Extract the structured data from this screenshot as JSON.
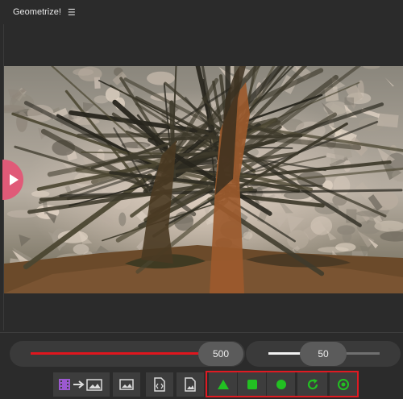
{
  "app": {
    "title": "Geometrize!",
    "menu_icon": "hamburger-menu-icon"
  },
  "canvas": {
    "description_icon": "geometrized-tree-image",
    "side_tab_icon": "play-icon"
  },
  "sliders": {
    "shape_count": {
      "value": "500",
      "fill_fraction": 1.0,
      "accent": "#e0161e"
    },
    "shapes_per_step": {
      "value": "50",
      "fill_fraction": 0.36,
      "accent": "#f2f2f2"
    }
  },
  "toolbar": {
    "left_buttons": [
      {
        "name": "video-to-image-button",
        "icon": "film-arrow-image-icon"
      },
      {
        "name": "open-image-button",
        "icon": "image-icon"
      },
      {
        "name": "save-svg-button",
        "icon": "code-file-icon"
      },
      {
        "name": "save-image-button",
        "icon": "image-file-icon"
      }
    ],
    "shape_buttons": [
      {
        "name": "triangle-shape-button",
        "icon": "triangle-icon"
      },
      {
        "name": "rectangle-shape-button",
        "icon": "square-icon"
      },
      {
        "name": "circle-shape-button",
        "icon": "circle-icon"
      },
      {
        "name": "reset-button",
        "icon": "refresh-icon"
      },
      {
        "name": "target-button",
        "icon": "target-icon"
      }
    ],
    "shape_color": "#22c022",
    "highlight_color": "#e01a22"
  }
}
